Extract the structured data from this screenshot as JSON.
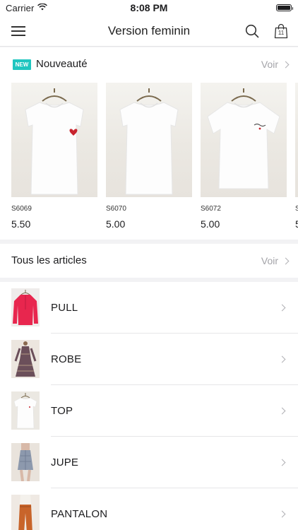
{
  "status_bar": {
    "carrier": "Carrier",
    "time": "8:08 PM"
  },
  "nav": {
    "title": "Version feminin",
    "bag_count": "11"
  },
  "new_section": {
    "badge": "NEW",
    "title": "Nouveauté",
    "see_all": "Voir",
    "products": [
      {
        "code": "S6069",
        "price": "5.50"
      },
      {
        "code": "S6070",
        "price": "5.00"
      },
      {
        "code": "S6072",
        "price": "5.00"
      },
      {
        "code": "S",
        "price": "5"
      }
    ]
  },
  "all_section": {
    "title": "Tous les articles",
    "see_all": "Voir"
  },
  "categories": [
    {
      "label": "PULL"
    },
    {
      "label": "ROBE"
    },
    {
      "label": "TOP"
    },
    {
      "label": "JUPE"
    },
    {
      "label": "PANTALON"
    }
  ],
  "colors": {
    "badge": "#1fc6c0",
    "separator": "#e6e6e8",
    "muted": "#a3a3a8"
  }
}
